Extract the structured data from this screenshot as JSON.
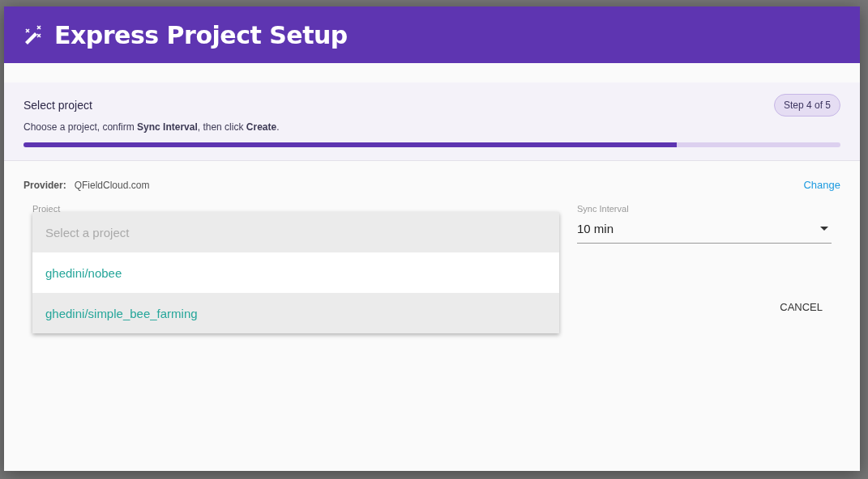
{
  "dialog": {
    "title": "Express Project Setup"
  },
  "step": {
    "title": "Select project",
    "instruction": "Choose a project, confirm **Sync Interval**, then click **Create**.",
    "badge": "Step 4 of 5",
    "progress": {
      "level": 0.8
    }
  },
  "provider": {
    "label": "Provider:",
    "value": "QFieldCloud.com",
    "action": "Change"
  },
  "project_field": {
    "label": "Project",
    "placeholder": "Select a project",
    "menu_open": true,
    "options": [
      {
        "label": "ghedini/nobee",
        "highlighted": false
      },
      {
        "label": "ghedini/simple_bee_farming",
        "highlighted": true
      }
    ]
  },
  "sync_field": {
    "label": "Sync Interval",
    "value": "10 min"
  },
  "buttons": [
    {
      "label": "CANCEL"
    }
  ]
}
